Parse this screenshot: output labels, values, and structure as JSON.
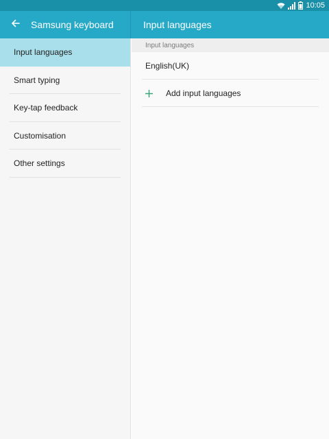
{
  "status_bar": {
    "time": "10:05",
    "icons": [
      "wifi-icon",
      "signal-icon",
      "battery-icon"
    ]
  },
  "app_bar": {
    "back_icon": "arrow-left-icon",
    "title": "Samsung keyboard",
    "detail_title": "Input languages"
  },
  "sidebar": {
    "items": [
      {
        "label": "Input languages",
        "selected": true
      },
      {
        "label": "Smart typing",
        "selected": false
      },
      {
        "label": "Key-tap feedback",
        "selected": false
      },
      {
        "label": "Customisation",
        "selected": false
      },
      {
        "label": "Other settings",
        "selected": false
      }
    ]
  },
  "content": {
    "section_header": "Input languages",
    "languages": [
      "English(UK)"
    ],
    "add_label": "Add input languages",
    "add_icon": "plus-icon"
  },
  "colors": {
    "status_bar": "#1a8fa8",
    "app_bar": "#25a9c6",
    "selected_item": "#a9dfea",
    "accent_plus": "#3aa57a"
  }
}
